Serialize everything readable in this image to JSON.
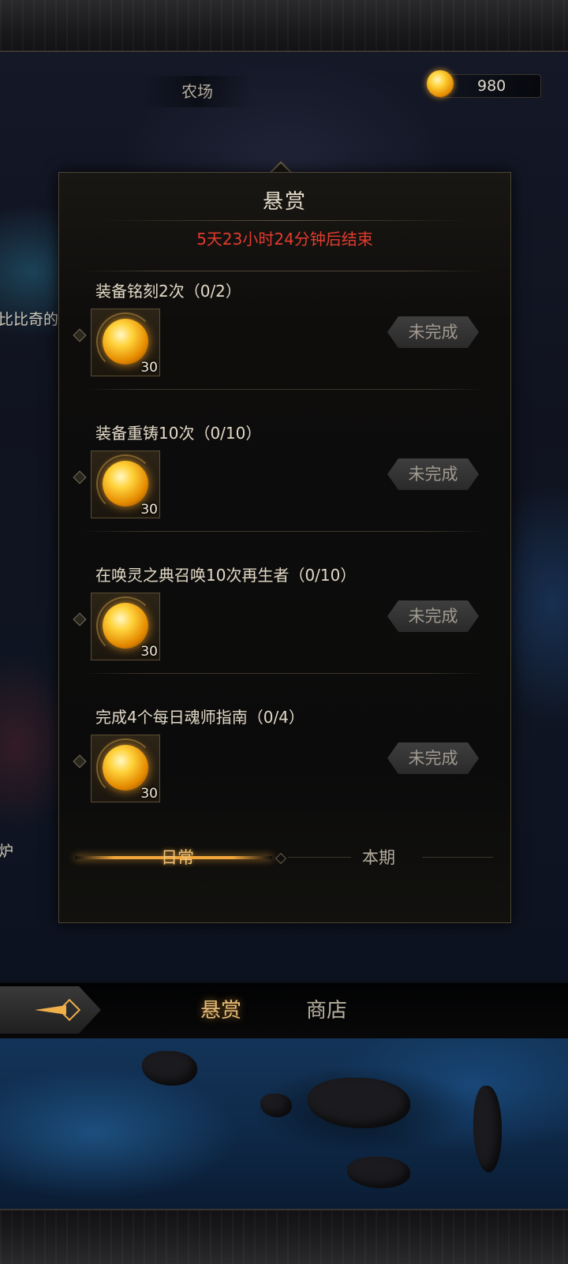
{
  "header": {
    "location": "农场",
    "currency": {
      "icon": "gold-orb-icon",
      "value": "980"
    }
  },
  "background_text": {
    "left_label_1": "比比奇的",
    "left_label_2": "炉"
  },
  "panel": {
    "title": "悬赏",
    "timer": "5天23小时24分钟后结束",
    "timer_color": "#e23b2e",
    "quests": [
      {
        "title": "装备铭刻2次（0/2）",
        "reward_icon": "gold-orb-icon",
        "reward_count": "30",
        "status": "未完成"
      },
      {
        "title": "装备重铸10次（0/10）",
        "reward_icon": "gold-orb-icon",
        "reward_count": "30",
        "status": "未完成"
      },
      {
        "title": "在唤灵之典召唤10次再生者（0/10）",
        "reward_icon": "gold-orb-icon",
        "reward_count": "30",
        "status": "未完成"
      },
      {
        "title": "完成4个每日魂师指南（0/4）",
        "reward_icon": "gold-orb-icon",
        "reward_count": "30",
        "status": "未完成"
      }
    ],
    "tabs": {
      "daily": "日常",
      "period": "本期",
      "active": "daily"
    }
  },
  "bottom_nav": {
    "tabs": [
      {
        "label": "悬赏",
        "active": true
      },
      {
        "label": "商店",
        "active": false
      }
    ],
    "accent_color": "#f2a63a"
  }
}
